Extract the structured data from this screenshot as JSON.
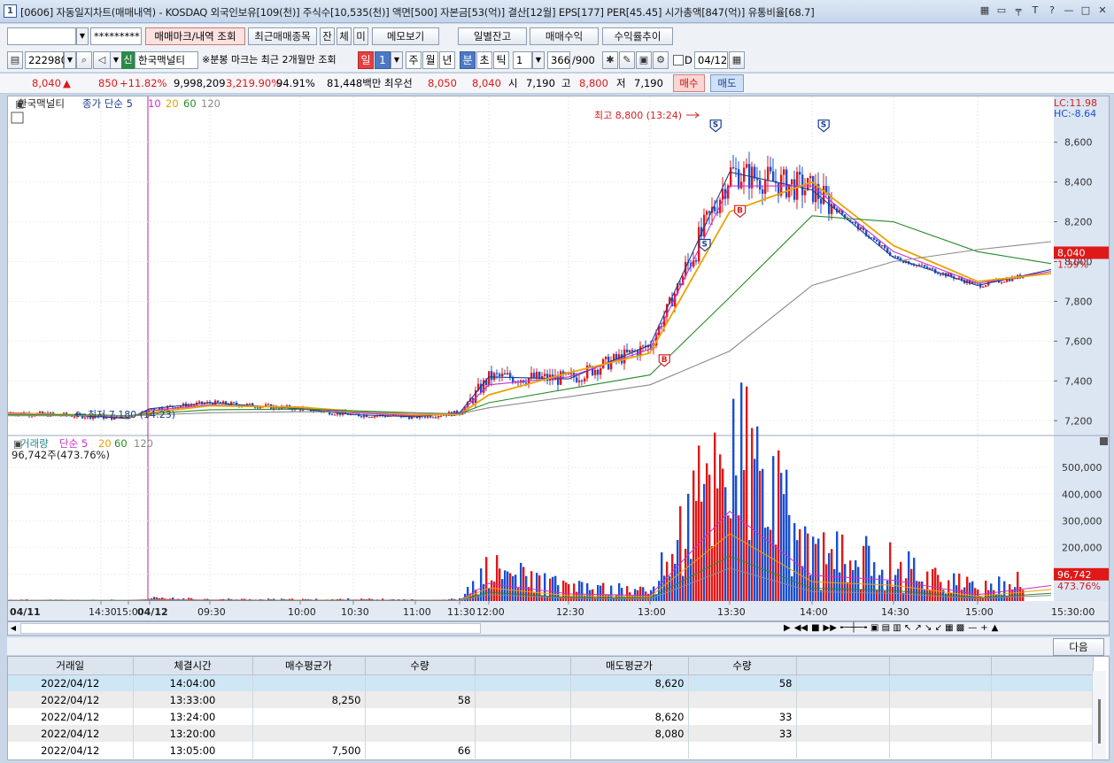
{
  "window": {
    "number": "1",
    "title": "[0606] 자동일지차트(매매내역) - KOSDAQ 외국인보유[109(천)] 주식수[10,535(천)] 액면[500] 자본금[53(억)] 결산[12월] EPS[177] PER[45.45] 시가총액[847(억)] 유통비율[68.7]",
    "icons": [
      "▦",
      "▭",
      "╤",
      "T",
      "?",
      "—",
      "□",
      "✕"
    ]
  },
  "toolbar1": {
    "account_value": "",
    "password_value": "*********",
    "buttons": [
      "매매마크/내역 조회",
      "최근매매종목",
      "잔",
      "체",
      "미",
      "메모보기",
      "일별잔고",
      "매매수익",
      "수익률추이"
    ]
  },
  "toolbar2": {
    "code": "222980",
    "stock_badge": "신",
    "stock_name": "한국맥널티",
    "notice": "※분봉 마크는 최근 2개월만 조회",
    "period_label": "일",
    "period_num": "1",
    "segments": [
      "주",
      "월",
      "년",
      "분",
      "초",
      "틱"
    ],
    "active_segment": "분",
    "interval": "1",
    "count": "366",
    "count_total": "/900",
    "d_label": "D",
    "date": "04/12"
  },
  "quote": {
    "price": "8,040",
    "arrow": "▲",
    "change": "850",
    "change_pct": "+11.82%",
    "volume": "9,998,209",
    "vol_ratio": "3,219.90%",
    "rate": "94.91%",
    "amount": "81,448백만",
    "best_label": "최우선",
    "ask": "8,050",
    "bid": "8,040",
    "open_label": "시",
    "open": "7,190",
    "high_label": "고",
    "high": "8,800",
    "low_label": "저",
    "low": "7,190",
    "buy_label": "매수",
    "sell_label": "매도"
  },
  "chart_labels": {
    "stock_tag": "한국맥널티",
    "price_legend": [
      "종가 단순 5",
      "10",
      "20",
      "60",
      "120"
    ],
    "vol_tag": "거래량",
    "vol_legend": [
      "단순 5",
      "20",
      "60",
      "120"
    ],
    "vol_value": "96,742주(473.76%)",
    "high_annot": "최고 8,800 (13:24)",
    "low_annot": "최저 7,180 (14:23)",
    "lc": "LC:11.98",
    "hc": "HC:-8.64",
    "price_box": "8,040",
    "price_box_pct": "1.39%",
    "vol_box": "96,742",
    "vol_box_pct": "473.76%",
    "marker_sell": "S",
    "marker_buy": "B",
    "x_labels": [
      "04/11",
      "14:30",
      "15:00",
      "04/12",
      "09:30",
      "10:00",
      "10:30",
      "11:00",
      "11:30",
      "12:00",
      "12:30",
      "13:00",
      "13:30",
      "14:00",
      "14:30",
      "15:00",
      "15:30:00"
    ]
  },
  "chart_data": [
    {
      "type": "line",
      "name": "price",
      "y_ticks": [
        "8,600",
        "8,400",
        "8,200",
        "8,000",
        "7,800",
        "7,600",
        "7,400",
        "7,200"
      ],
      "ylim": [
        7130,
        8830
      ],
      "x": [
        "04/11",
        "14:30",
        "15:00",
        "04/12",
        "09:30",
        "10:00",
        "10:30",
        "11:00",
        "11:30",
        "12:00",
        "12:30",
        "13:00",
        "13:30",
        "14:00",
        "14:30",
        "15:00",
        "15:30:00"
      ],
      "series": [
        {
          "name": "종가 단순 5",
          "values": [
            7240,
            7220,
            7210,
            7260,
            7290,
            7260,
            7230,
            7220,
            7240,
            7420,
            7410,
            7580,
            8450,
            8360,
            8020,
            7880,
            7960
          ]
        },
        {
          "name": "10",
          "values": [
            7240,
            7225,
            7215,
            7250,
            7280,
            7265,
            7240,
            7225,
            7235,
            7380,
            7420,
            7560,
            8380,
            8380,
            8050,
            7890,
            7950
          ]
        },
        {
          "name": "20",
          "values": [
            7235,
            7228,
            7220,
            7240,
            7275,
            7268,
            7248,
            7230,
            7232,
            7330,
            7440,
            7540,
            8250,
            8400,
            8080,
            7900,
            7940
          ]
        },
        {
          "name": "60",
          "values": [
            7230,
            7228,
            7225,
            7235,
            7255,
            7258,
            7250,
            7240,
            7235,
            7290,
            7360,
            7430,
            7820,
            8230,
            8200,
            8050,
            7990
          ]
        },
        {
          "name": "120",
          "values": [
            7225,
            7225,
            7224,
            7228,
            7240,
            7245,
            7243,
            7238,
            7235,
            7265,
            7320,
            7380,
            7550,
            7880,
            8000,
            8060,
            8100
          ]
        }
      ],
      "markers": [
        {
          "label": "S",
          "x": "13:24",
          "y": 8680
        },
        {
          "label": "S",
          "x": "14:04",
          "y": 8680
        },
        {
          "label": "S",
          "x": "13:20",
          "y": 8080
        },
        {
          "label": "B",
          "x": "13:33",
          "y": 8250
        },
        {
          "label": "B",
          "x": "13:05",
          "y": 7500
        }
      ]
    },
    {
      "type": "bar",
      "name": "volume",
      "y_ticks": [
        "500,000",
        "400,000",
        "300,000",
        "200,000",
        "100,000"
      ],
      "ylim": [
        0,
        580000
      ],
      "x": [
        "04/11",
        "14:30",
        "15:00",
        "04/12",
        "09:30",
        "10:00",
        "10:30",
        "11:00",
        "11:30",
        "12:00",
        "12:30",
        "13:00",
        "13:30",
        "14:00",
        "14:30",
        "15:00",
        "15:30:00"
      ],
      "values": [
        4000,
        3000,
        4000,
        9000,
        6000,
        5000,
        6000,
        4000,
        6000,
        110000,
        45000,
        35000,
        560000,
        160000,
        130000,
        40000,
        96742
      ]
    }
  ],
  "grid": {
    "next_label": "다음",
    "columns": [
      "거래일",
      "체결시간",
      "매수평균가",
      "수량",
      "",
      "매도평균가",
      "수량",
      "",
      "",
      ""
    ],
    "rows": [
      [
        "2022/04/12",
        "14:04:00",
        "",
        "",
        "",
        "8,620",
        "58",
        "",
        "",
        ""
      ],
      [
        "2022/04/12",
        "13:33:00",
        "8,250",
        "58",
        "",
        "",
        "",
        "",
        "",
        ""
      ],
      [
        "2022/04/12",
        "13:24:00",
        "",
        "",
        "",
        "8,620",
        "33",
        "",
        "",
        ""
      ],
      [
        "2022/04/12",
        "13:20:00",
        "",
        "",
        "",
        "8,080",
        "33",
        "",
        "",
        ""
      ],
      [
        "2022/04/12",
        "13:05:00",
        "7,500",
        "66",
        "",
        "",
        "",
        "",
        "",
        ""
      ]
    ]
  },
  "colors": {
    "up": "#e01818",
    "down": "#1a4fd0",
    "ma5": "#1a3d8c",
    "ma10": "#cc2fcc",
    "ma20": "#e8a400",
    "ma60": "#2a8a2a",
    "ma120": "#8a8a8a"
  }
}
